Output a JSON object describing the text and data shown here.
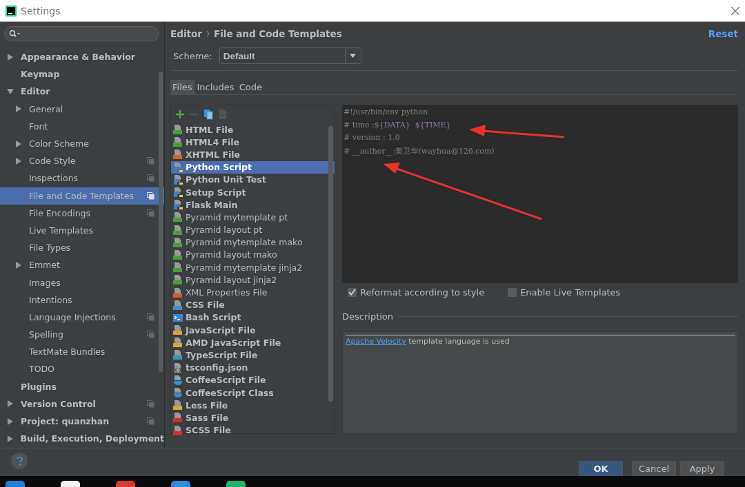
{
  "window": {
    "title": "Settings"
  },
  "sidebar": {
    "items": [
      {
        "label": "Appearance & Behavior",
        "expanded": false,
        "selected": false,
        "per_project": false
      },
      {
        "label": "Keymap",
        "selected": false,
        "per_project": false
      },
      {
        "label": "Editor",
        "expanded": true,
        "selected": false,
        "per_project": false,
        "children": [
          {
            "label": "General",
            "expanded": false,
            "selected": false,
            "per_project": false
          },
          {
            "label": "Font",
            "selected": false,
            "per_project": false
          },
          {
            "label": "Color Scheme",
            "expanded": false,
            "selected": false,
            "per_project": false
          },
          {
            "label": "Code Style",
            "expanded": false,
            "selected": false,
            "per_project": true
          },
          {
            "label": "Inspections",
            "selected": false,
            "per_project": true
          },
          {
            "label": "File and Code Templates",
            "selected": true,
            "per_project": true
          },
          {
            "label": "File Encodings",
            "selected": false,
            "per_project": true
          },
          {
            "label": "Live Templates",
            "selected": false,
            "per_project": false
          },
          {
            "label": "File Types",
            "selected": false,
            "per_project": false
          },
          {
            "label": "Emmet",
            "expanded": false,
            "selected": false,
            "per_project": false
          },
          {
            "label": "Images",
            "selected": false,
            "per_project": false
          },
          {
            "label": "Intentions",
            "selected": false,
            "per_project": false
          },
          {
            "label": "Language Injections",
            "selected": false,
            "per_project": true
          },
          {
            "label": "Spelling",
            "selected": false,
            "per_project": true
          },
          {
            "label": "TextMate Bundles",
            "selected": false,
            "per_project": false
          },
          {
            "label": "TODO",
            "selected": false,
            "per_project": false
          }
        ]
      },
      {
        "label": "Plugins",
        "selected": false,
        "per_project": false
      },
      {
        "label": "Version Control",
        "expanded": false,
        "selected": false,
        "per_project": true
      },
      {
        "label": "Project: quanzhan",
        "expanded": false,
        "selected": false,
        "per_project": true
      },
      {
        "label": "Build, Execution, Deployment",
        "expanded": false,
        "selected": false,
        "per_project": false
      }
    ]
  },
  "header": {
    "breadcrumb": [
      "Editor",
      "File and Code Templates"
    ],
    "reset": "Reset"
  },
  "scheme": {
    "label": "Scheme:",
    "value": "Default"
  },
  "tabs": [
    {
      "label": "Files",
      "selected": true
    },
    {
      "label": "Includes",
      "selected": false
    },
    {
      "label": "Code",
      "selected": false
    }
  ],
  "templates": [
    {
      "label": "HTML File",
      "bold": true,
      "selected": false,
      "kind": "file",
      "color": "#4c9a3f"
    },
    {
      "label": "HTML4 File",
      "bold": true,
      "selected": false,
      "kind": "file",
      "color": "#4c9a3f"
    },
    {
      "label": "XHTML File",
      "bold": true,
      "selected": false,
      "kind": "file",
      "color": "#d3602a"
    },
    {
      "label": "Python Script",
      "bold": true,
      "selected": true,
      "kind": "python",
      "color": "#3f7fbf"
    },
    {
      "label": "Python Unit Test",
      "bold": true,
      "selected": false,
      "kind": "python",
      "color": "#3f7fbf"
    },
    {
      "label": "Setup Script",
      "bold": true,
      "selected": false,
      "kind": "python",
      "color": "#3f7fbf"
    },
    {
      "label": "Flask Main",
      "bold": true,
      "selected": false,
      "kind": "python",
      "color": "#3f7fbf"
    },
    {
      "label": "Pyramid mytemplate pt",
      "bold": false,
      "selected": false,
      "kind": "file",
      "color": "#4c9a3f"
    },
    {
      "label": "Pyramid layout pt",
      "bold": false,
      "selected": false,
      "kind": "file",
      "color": "#4c9a3f"
    },
    {
      "label": "Pyramid mytemplate mako",
      "bold": false,
      "selected": false,
      "kind": "file",
      "color": "#4c9a3f"
    },
    {
      "label": "Pyramid layout mako",
      "bold": false,
      "selected": false,
      "kind": "file",
      "color": "#4c9a3f"
    },
    {
      "label": "Pyramid mytemplate jinja2",
      "bold": false,
      "selected": false,
      "kind": "file",
      "color": "#4c9a3f"
    },
    {
      "label": "Pyramid layout jinja2",
      "bold": false,
      "selected": false,
      "kind": "file",
      "color": "#4c9a3f"
    },
    {
      "label": "XML Properties File",
      "bold": false,
      "selected": false,
      "kind": "file",
      "color": "#d3602a"
    },
    {
      "label": "CSS File",
      "bold": true,
      "selected": false,
      "kind": "file",
      "color": "#3b8fc4"
    },
    {
      "label": "Bash Script",
      "bold": true,
      "selected": false,
      "kind": "terminal",
      "color": "#3f7fd0"
    },
    {
      "label": "JavaScript File",
      "bold": true,
      "selected": false,
      "kind": "file",
      "color": "#d9a43a"
    },
    {
      "label": "AMD JavaScript File",
      "bold": true,
      "selected": false,
      "kind": "file",
      "color": "#d9a43a"
    },
    {
      "label": "TypeScript File",
      "bold": true,
      "selected": false,
      "kind": "file",
      "color": "#3a94b8"
    },
    {
      "label": "tsconfig.json",
      "bold": true,
      "selected": false,
      "kind": "json",
      "color": "#9a9a9a"
    },
    {
      "label": "CoffeeScript File",
      "bold": true,
      "selected": false,
      "kind": "cup",
      "color": "#2f8fd0"
    },
    {
      "label": "CoffeeScript Class",
      "bold": true,
      "selected": false,
      "kind": "cup",
      "color": "#2f8fd0"
    },
    {
      "label": "Less File",
      "bold": true,
      "selected": false,
      "kind": "file",
      "color": "#d9a43a"
    },
    {
      "label": "Sass File",
      "bold": true,
      "selected": false,
      "kind": "file",
      "color": "#c8352e"
    },
    {
      "label": "SCSS File",
      "bold": true,
      "selected": false,
      "kind": "file",
      "color": "#c8352e"
    }
  ],
  "code": [
    [
      {
        "text": "#!/usr/bin/env python",
        "kind": "comment"
      }
    ],
    [
      {
        "text": "# time :",
        "kind": "comment"
      },
      {
        "text": "${DATA}  ${TIME}",
        "kind": "variable"
      }
    ],
    [
      {
        "text": "# version : 1.0",
        "kind": "comment"
      }
    ],
    [
      {
        "text": "# __author__:黄卫华(wayhua@126.com)",
        "kind": "comment"
      }
    ]
  ],
  "options": [
    {
      "label": "Reformat according to style",
      "checked": true
    },
    {
      "label": "Enable Live Templates",
      "checked": false
    }
  ],
  "description": {
    "title": "Description",
    "link": "Apache Velocity",
    "text": " template language is used"
  },
  "buttons": [
    {
      "label": "OK",
      "kind": "primary"
    },
    {
      "label": "Cancel",
      "kind": "normal"
    },
    {
      "label": "Apply",
      "kind": "normal"
    }
  ]
}
